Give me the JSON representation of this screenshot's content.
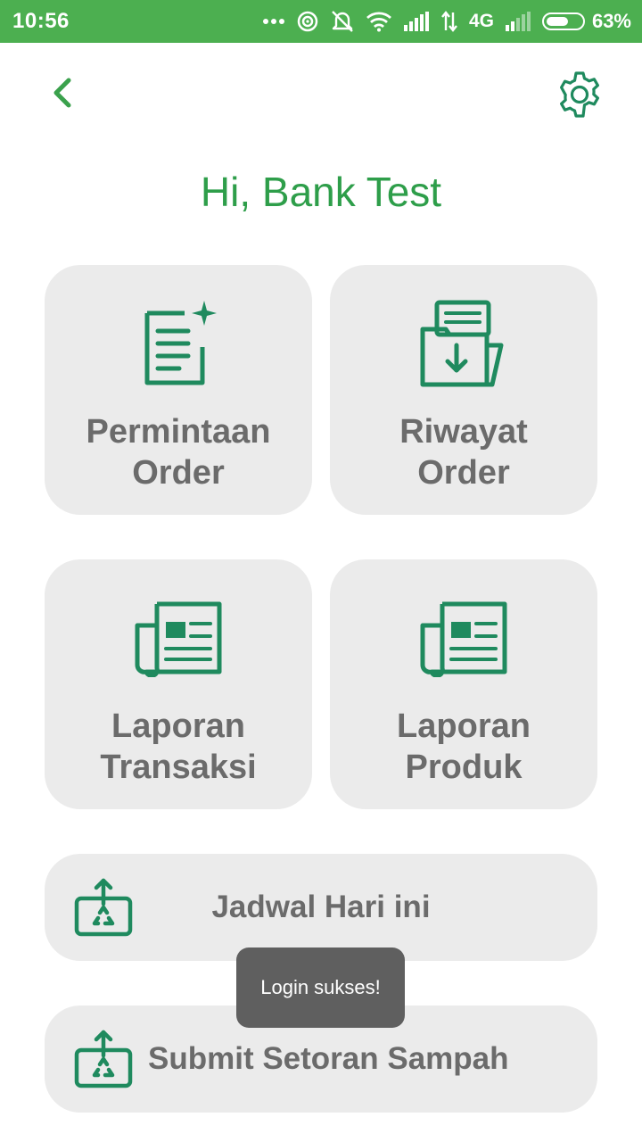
{
  "status_bar": {
    "time": "10:56",
    "network": "4G",
    "battery_level": 0.63,
    "battery_pct": "63%",
    "icons": [
      "more-dots-icon",
      "hotspot-icon",
      "mute-icon",
      "wifi-icon",
      "signal-icon",
      "data-arrows-icon",
      "signal-weak-icon",
      "battery-icon"
    ]
  },
  "header": {
    "back_icon": "chevron-left-icon",
    "settings_icon": "gear-icon"
  },
  "greeting": "Hi, Bank Test",
  "tiles": [
    {
      "label": "Permintaan\nOrder",
      "icon": "document-add-icon"
    },
    {
      "label": "Riwayat\nOrder",
      "icon": "folder-download-icon"
    },
    {
      "label": "Laporan\nTransaksi",
      "icon": "newspaper-icon"
    },
    {
      "label": "Laporan\nProduk",
      "icon": "newspaper-icon"
    }
  ],
  "actions": [
    {
      "label": "Jadwal Hari ini",
      "icon": "recycle-upload-icon"
    },
    {
      "label": "Submit Setoran Sampah",
      "icon": "recycle-upload-icon"
    }
  ],
  "toast": "Login sukses!",
  "colors": {
    "status_bar": "#4caf50",
    "accent": "#2e9e4a",
    "icon_green": "#1f8a5e",
    "tile_bg": "#ebebeb",
    "tile_text": "#6b6b6b",
    "toast_bg": "#5f5f5f"
  }
}
